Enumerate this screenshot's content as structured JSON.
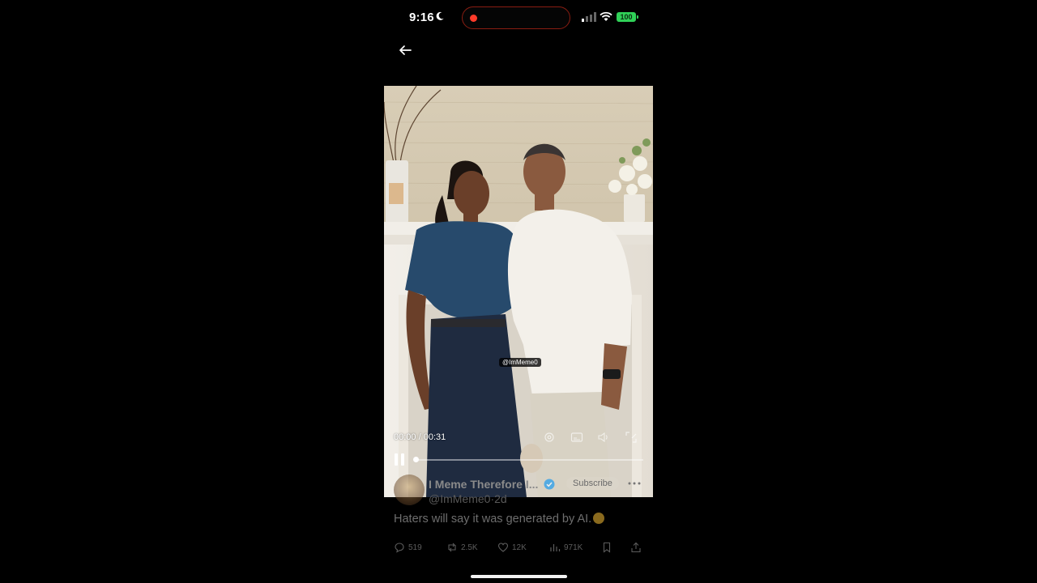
{
  "status_bar": {
    "time": "9:16",
    "battery": "100"
  },
  "video": {
    "watermark": "@ImMeme0",
    "current_time": "00:00",
    "duration": "00:31",
    "progress": 0.0
  },
  "tweet": {
    "display_name": "I Meme Therefore I...",
    "handle": "@ImMeme0",
    "separator": "·",
    "age": "2d",
    "subscribe_label": "Subscribe",
    "text": "Haters will say it was generated by AI.",
    "emoji": "☺"
  },
  "actions": {
    "replies": "519",
    "reposts": "2.5K",
    "likes": "12K",
    "views": "971K"
  },
  "colors": {
    "accent_red": "#ff3b2a",
    "battery_green": "#30d158",
    "verified_blue": "#1d9bf0"
  }
}
